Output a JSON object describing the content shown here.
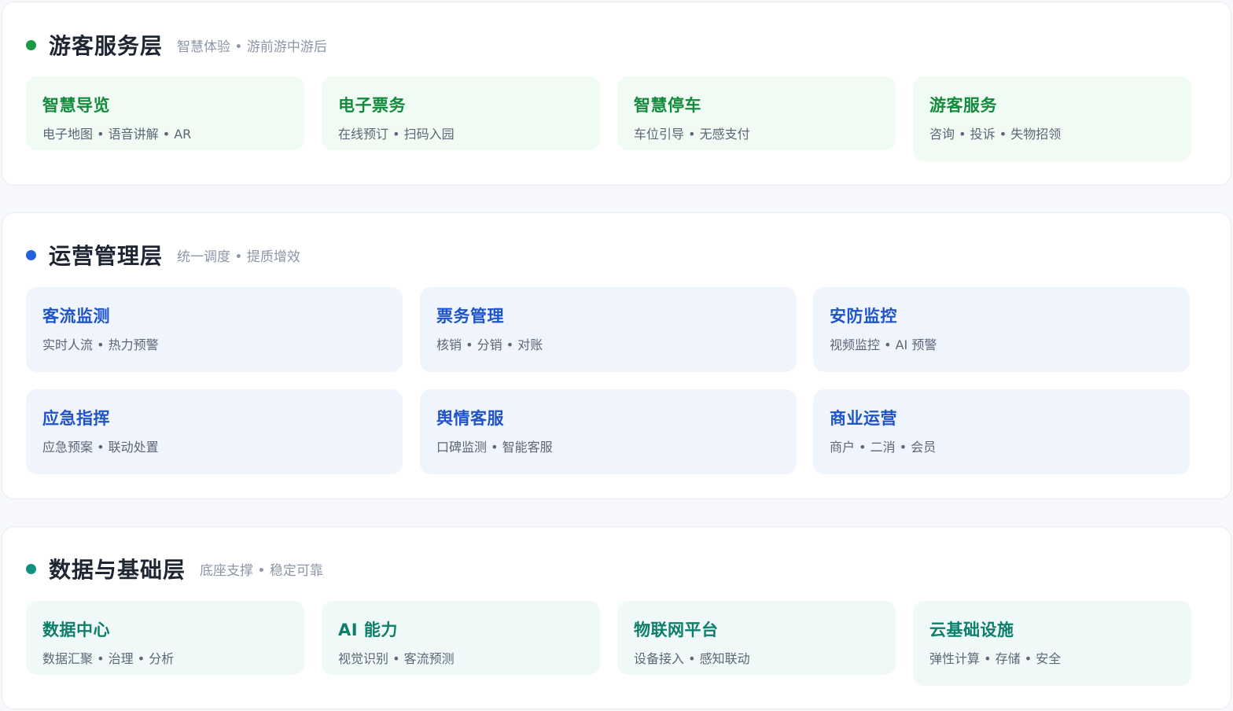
{
  "colors": {
    "visitor_accent": "#1a9a45",
    "visitor_title": "#158a3d",
    "visitor_card_bg": "#effbf3",
    "ops_accent": "#2361dd",
    "ops_title": "#1f54c9",
    "ops_card_bg": "#eff4fd",
    "data_accent": "#13907f",
    "data_title": "#0f7d6c",
    "data_card_bg": "#effaf8"
  },
  "layers": [
    {
      "id": "visitor",
      "title": "游客服务层",
      "subtitle": "智慧体验 • 游前游中游后",
      "cards": [
        {
          "title": "智慧导览",
          "desc": "电子地图 • 语音讲解 • AR"
        },
        {
          "title": "电子票务",
          "desc": "在线预订 • 扫码入园"
        },
        {
          "title": "智慧停车",
          "desc": "车位引导 • 无感支付"
        },
        {
          "title": "游客服务",
          "desc": "咨询 • 投诉 • 失物招领"
        }
      ]
    },
    {
      "id": "ops",
      "title": "运营管理层",
      "subtitle": "统一调度 • 提质增效",
      "cards": [
        {
          "title": "客流监测",
          "desc": "实时人流 • 热力预警"
        },
        {
          "title": "票务管理",
          "desc": "核销 • 分销 • 对账"
        },
        {
          "title": "安防监控",
          "desc": "视频监控 • AI 预警"
        },
        {
          "title": "应急指挥",
          "desc": "应急预案 • 联动处置"
        },
        {
          "title": "舆情客服",
          "desc": "口碑监测 • 智能客服"
        },
        {
          "title": "商业运营",
          "desc": "商户 • 二消 • 会员"
        }
      ]
    },
    {
      "id": "data",
      "title": "数据与基础层",
      "subtitle": "底座支撑 • 稳定可靠",
      "cards": [
        {
          "title": "数据中心",
          "desc": "数据汇聚 • 治理 • 分析"
        },
        {
          "title": "AI 能力",
          "desc": "视觉识别 • 客流预测"
        },
        {
          "title": "物联网平台",
          "desc": "设备接入 • 感知联动"
        },
        {
          "title": "云基础设施",
          "desc": "弹性计算 • 存储 • 安全"
        }
      ]
    }
  ]
}
